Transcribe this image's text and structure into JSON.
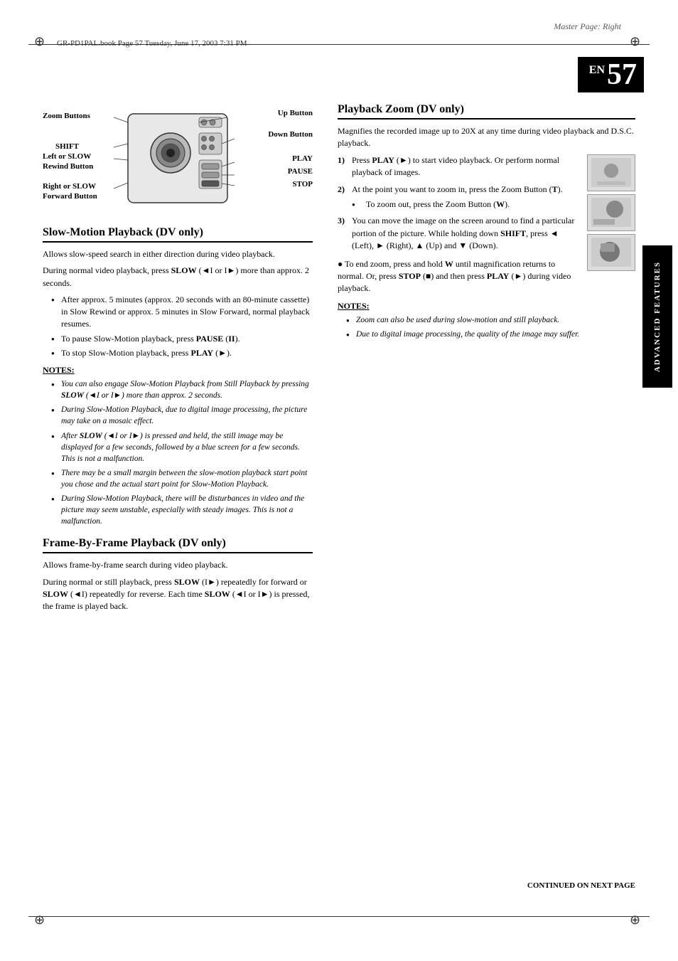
{
  "page": {
    "master_page": "Master Page: Right",
    "file_info": "GR-PD1PAL.book  Page 57  Tuesday, June 17, 2003  7:31 PM",
    "page_number": "57",
    "en_label": "EN"
  },
  "diagram": {
    "labels": {
      "zoom_buttons": "Zoom Buttons",
      "shift": "SHIFT",
      "left_slow": "Left or SLOW\nRewind Button",
      "right_slow": "Right or SLOW\nForward Button",
      "up_button": "Up Button",
      "down_button": "Down Button",
      "play": "PLAY",
      "pause": "PAUSE",
      "stop": "STOP"
    }
  },
  "slow_motion": {
    "heading": "Slow-Motion Playback (DV only)",
    "intro": "Allows slow-speed search in either direction during video playback.",
    "para1": "During normal video playback, press SLOW (◄ or ►) more than approx. 2 seconds.",
    "bullets": [
      "After approx. 5 minutes (approx. 20 seconds with an 80-minute cassette) in Slow Rewind or approx. 5 minutes in Slow Forward, normal playback resumes.",
      "To pause Slow-Motion playback, press PAUSE (II).",
      "To stop Slow-Motion playback, press PLAY (►)."
    ],
    "notes_heading": "NOTES:",
    "notes": [
      "You can also engage Slow-Motion Playback from Still Playback by pressing SLOW (◄ or ►) more than approx. 2 seconds.",
      "During Slow-Motion Playback, due to digital image processing, the picture may take on a mosaic effect.",
      "After SLOW (◄ or ►) is pressed and held, the still image may be displayed for a few seconds, followed by a blue screen for a few seconds. This is not a malfunction.",
      "There may be a small margin between the slow-motion playback start point you chose and the actual start point for Slow-Motion Playback.",
      "During Slow-Motion Playback, there will be disturbances in video and the picture may seem unstable, especially with steady images. This is not a malfunction."
    ]
  },
  "frame_by_frame": {
    "heading": "Frame-By-Frame Playback (DV only)",
    "intro": "Allows frame-by-frame search during video playback.",
    "para1": "During normal or still playback, press SLOW (I►) repeatedly for forward or SLOW (◄I) repeatedly for reverse. Each time SLOW (◄I or I►) is pressed, the frame is played back."
  },
  "playback_zoom": {
    "heading": "Playback Zoom (DV only)",
    "intro": "Magnifies the recorded image up to 20X at any time during video playback and D.S.C. playback.",
    "steps": [
      {
        "num": "1)",
        "text": "Press PLAY (►) to start video playback. Or perform normal playback of images."
      },
      {
        "num": "2)",
        "text": "At the point you want to zoom in, press the Zoom Button (T).",
        "sub_bullets": [
          "To zoom out, press the Zoom Button (W)."
        ]
      },
      {
        "num": "3)",
        "text": "You can move the image on the screen around to find a particular portion of the picture. While holding down SHIFT, press ◄ (Left), ► (Right), ▲ (Up) and ▼ (Down)."
      }
    ],
    "end_note": "To end zoom, press and hold W until magnification returns to normal. Or, press STOP (■) and then press PLAY (►) during video playback.",
    "notes_heading": "NOTES:",
    "notes": [
      "Zoom can also be used during slow-motion and still playback.",
      "Due to digital image processing, the quality of the image may suffer."
    ]
  },
  "sidebar": {
    "label": "ADVANCED FEATURES"
  },
  "footer": {
    "continued": "CONTINUED ON NEXT PAGE"
  }
}
